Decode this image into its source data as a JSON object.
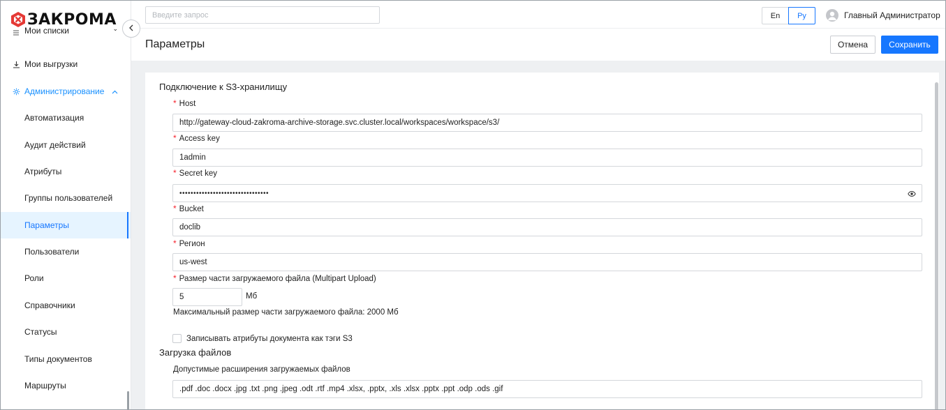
{
  "brand": {
    "logo_text": "ЗАКРОМА",
    "logo_icon": "brand-hex-icon",
    "accent": "#1677ff",
    "logo_red": "#e53935"
  },
  "search": {
    "placeholder": "Введите запрос",
    "value": ""
  },
  "languages": {
    "en": "En",
    "ru": "Ру",
    "selected": "Ру"
  },
  "user": {
    "name": "Главный Администратор",
    "icon": "user-avatar-icon"
  },
  "sidebar": {
    "collapse_icon": "chevron-left-icon",
    "items": [
      {
        "label": "Мои списки",
        "icon": "list-icon"
      },
      {
        "label": "Мои выгрузки",
        "icon": "download-icon"
      },
      {
        "label": "Администрирование",
        "icon": "gear-icon",
        "expanded": true
      },
      {
        "label": "Автоматизация"
      },
      {
        "label": "Аудит действий"
      },
      {
        "label": "Атрибуты"
      },
      {
        "label": "Группы пользователей"
      },
      {
        "label": "Параметры",
        "active": true
      },
      {
        "label": "Пользователи"
      },
      {
        "label": "Роли"
      },
      {
        "label": "Справочники"
      },
      {
        "label": "Статусы"
      },
      {
        "label": "Типы документов"
      },
      {
        "label": "Маршруты"
      }
    ]
  },
  "page": {
    "title": "Параметры",
    "cancel_label": "Отмена",
    "save_label": "Сохранить"
  },
  "s3": {
    "section_title": "Подключение к S3-хранилищу",
    "host": {
      "label": "Host",
      "value": "http://gateway-cloud-zakroma-archive-storage.svc.cluster.local/workspaces/workspace/s3/"
    },
    "access_key": {
      "label": "Access key",
      "value": "1admin"
    },
    "secret_key": {
      "label": "Secret key",
      "value": "••••••••••••••••••••••••••••••••"
    },
    "bucket": {
      "label": "Bucket",
      "value": "doclib"
    },
    "region": {
      "label": "Регион",
      "value": "us-west"
    },
    "part_size": {
      "label": "Размер части загружаемого файла (Multipart Upload)",
      "value": "5",
      "unit": "Мб"
    },
    "part_hint": "Максимальный размер части загружаемого файла: 2000 Мб",
    "tags_checkbox": {
      "label": "Записывать атрибуты документа как тэги S3",
      "checked": false
    }
  },
  "upload": {
    "section_title": "Загрузка файлов",
    "extensions_label": "Допустимые расширения загружаемых файлов",
    "extensions_value": ".pdf .doc .docx .jpg .txt .png .jpeg .odt .rtf .mp4 .xlsx, .pptx, .xls .xlsx .pptx .ppt .odp .ods .gif"
  }
}
